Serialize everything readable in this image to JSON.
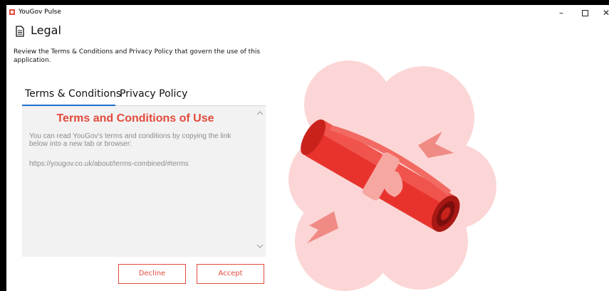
{
  "window": {
    "app_title": "YouGov Pulse",
    "minimize": "–",
    "close": "✕"
  },
  "page": {
    "title": "Legal",
    "description": "Review the Terms & Conditions and Privacy Policy that govern the use of this application."
  },
  "tabs": [
    {
      "label": "Terms & Conditions",
      "selected": true
    },
    {
      "label": "Privacy Policy",
      "selected": false
    }
  ],
  "content": {
    "heading": "Terms and Conditions of Use",
    "body": "You can read YouGov's terms and conditions by copying the link below into a new tab or browser:",
    "link": "https://yougov.co.uk/about/terms-combined/#terms"
  },
  "buttons": {
    "decline": "Decline",
    "accept": "Accept"
  },
  "colors": {
    "accent": "#e24a3c",
    "tab_underline": "#1f6fd1",
    "cloud": "#fcd6d6",
    "scroll_red": "#e8332d"
  },
  "icons": {
    "app": "app-icon",
    "page": "document-icon",
    "illustration": "scroll-diploma-icon"
  }
}
